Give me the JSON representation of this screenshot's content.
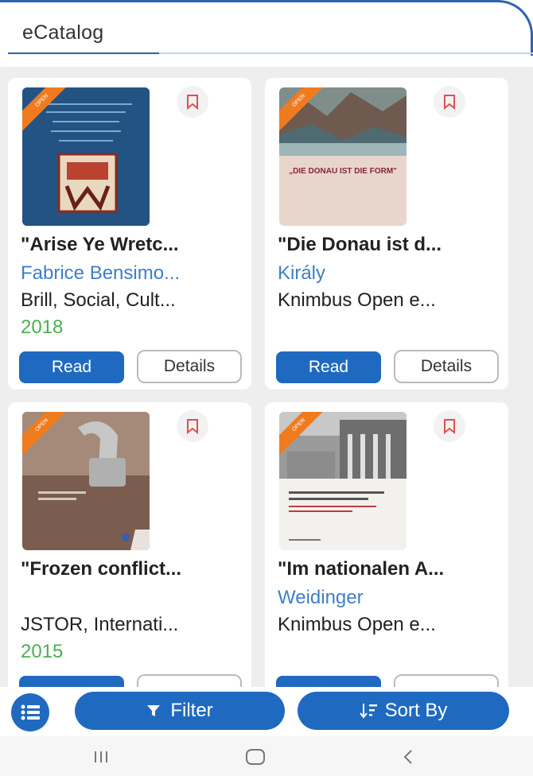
{
  "header": {
    "title": "eCatalog"
  },
  "cards": [
    {
      "ribbon": "OPEN",
      "title": "\"Arise Ye Wretc...",
      "author": "Fabrice Bensimo...",
      "publisher": "Brill, Social, Cult...",
      "year": "2018",
      "read_label": "Read",
      "details_label": "Details"
    },
    {
      "ribbon": "OPEN",
      "title": "\"Die Donau ist d...",
      "author": "Király",
      "publisher": "Knimbus Open e...",
      "year": "",
      "read_label": "Read",
      "details_label": "Details",
      "cover_text": "„DIE DONAU IST DIE FORM\""
    },
    {
      "ribbon": "OPEN",
      "title": "\"Frozen conflict...",
      "author": "",
      "publisher": "JSTOR, Internati...",
      "year": "2015",
      "read_label": "",
      "details_label": ""
    },
    {
      "ribbon": "OPEN",
      "title": "\"Im nationalen A...",
      "author": "Weidinger",
      "publisher": "Knimbus Open e...",
      "year": "",
      "read_label": "",
      "details_label": ""
    }
  ],
  "toolbar": {
    "filter_label": "Filter",
    "sort_label": "Sort By"
  },
  "colors": {
    "primary": "#1f6ac0",
    "author": "#3d7fc9",
    "year": "#4caf50",
    "ribbon": "#f07b1e",
    "bookmark": "#e05050"
  }
}
